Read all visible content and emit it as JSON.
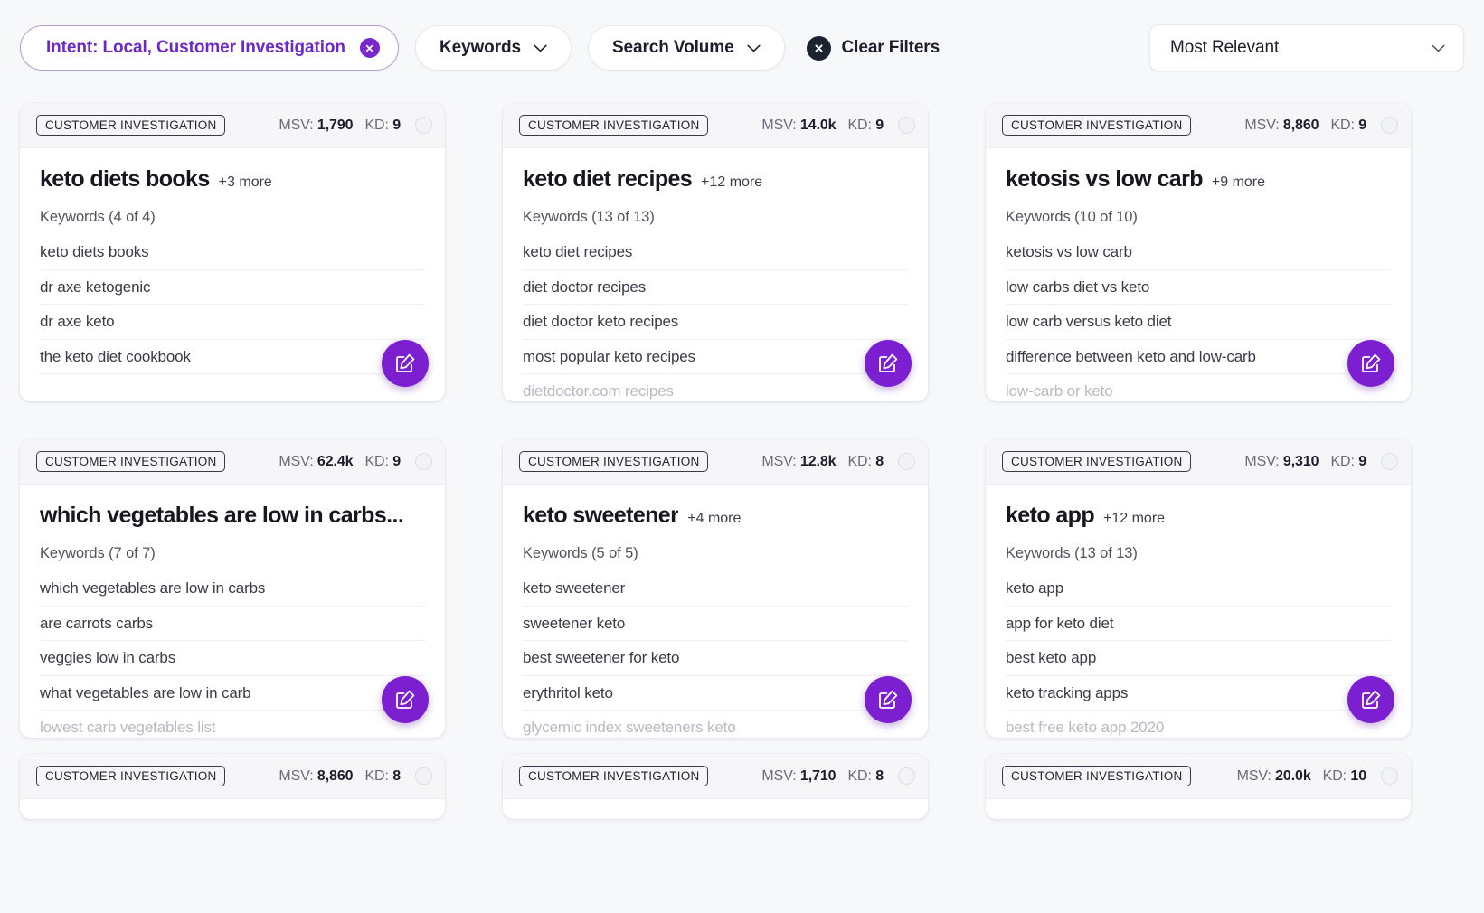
{
  "toolbar": {
    "intent_chip": {
      "label": "Intent: Local, Customer Investigation",
      "close_icon": "close-icon",
      "accent_color": "#7b27cf"
    },
    "keywords_filter": {
      "label": "Keywords",
      "icon": "chevron-down-icon"
    },
    "search_volume_filter": {
      "label": "Search Volume",
      "icon": "chevron-down-icon"
    },
    "clear_filters": {
      "label": "Clear Filters",
      "icon": "close-circle-icon"
    },
    "sort_select": {
      "value": "Most Relevant",
      "icon": "chevron-down-icon"
    }
  },
  "cards": [
    {
      "tag": "CUSTOMER INVESTIGATION",
      "msv_label": "MSV:",
      "msv_value": "1,790",
      "kd_label": "KD:",
      "kd_value": "9",
      "title": "keto diets books",
      "more": "+3 more",
      "keywords_count": "Keywords (4 of 4)",
      "keywords": [
        {
          "text": "keto diets books",
          "faded": false
        },
        {
          "text": "dr axe ketogenic",
          "faded": false
        },
        {
          "text": "dr axe keto",
          "faded": false
        },
        {
          "text": "the keto diet cookbook",
          "faded": false
        }
      ]
    },
    {
      "tag": "CUSTOMER INVESTIGATION",
      "msv_label": "MSV:",
      "msv_value": "14.0k",
      "kd_label": "KD:",
      "kd_value": "9",
      "title": "keto diet recipes",
      "more": "+12 more",
      "keywords_count": "Keywords (13 of 13)",
      "keywords": [
        {
          "text": "keto diet recipes",
          "faded": false
        },
        {
          "text": "diet doctor recipes",
          "faded": false
        },
        {
          "text": "diet doctor keto recipes",
          "faded": false
        },
        {
          "text": "most popular keto recipes",
          "faded": false
        },
        {
          "text": "dietdoctor.com recipes",
          "faded": true
        }
      ]
    },
    {
      "tag": "CUSTOMER INVESTIGATION",
      "msv_label": "MSV:",
      "msv_value": "8,860",
      "kd_label": "KD:",
      "kd_value": "9",
      "title": "ketosis vs low carb",
      "more": "+9 more",
      "keywords_count": "Keywords (10 of 10)",
      "keywords": [
        {
          "text": "ketosis vs low carb",
          "faded": false
        },
        {
          "text": "low carbs diet vs keto",
          "faded": false
        },
        {
          "text": "low carb versus keto diet",
          "faded": false
        },
        {
          "text": "difference between keto and low-carb",
          "faded": false
        },
        {
          "text": "low-carb or keto",
          "faded": true
        }
      ]
    },
    {
      "tag": "CUSTOMER INVESTIGATION",
      "msv_label": "MSV:",
      "msv_value": "62.4k",
      "kd_label": "KD:",
      "kd_value": "9",
      "title": "which vegetables are low in carbs...",
      "more": "",
      "keywords_count": "Keywords (7 of 7)",
      "keywords": [
        {
          "text": "which vegetables are low in carbs",
          "faded": false
        },
        {
          "text": "are carrots carbs",
          "faded": false
        },
        {
          "text": "veggies low in carbs",
          "faded": false
        },
        {
          "text": "what vegetables are low in carb",
          "faded": false
        },
        {
          "text": "lowest carb vegetables list",
          "faded": true
        }
      ]
    },
    {
      "tag": "CUSTOMER INVESTIGATION",
      "msv_label": "MSV:",
      "msv_value": "12.8k",
      "kd_label": "KD:",
      "kd_value": "8",
      "title": "keto sweetener",
      "more": "+4 more",
      "keywords_count": "Keywords (5 of 5)",
      "keywords": [
        {
          "text": "keto sweetener",
          "faded": false
        },
        {
          "text": "sweetener keto",
          "faded": false
        },
        {
          "text": "best sweetener for keto",
          "faded": false
        },
        {
          "text": "erythritol keto",
          "faded": false
        },
        {
          "text": "glycemic index sweeteners keto",
          "faded": true
        }
      ]
    },
    {
      "tag": "CUSTOMER INVESTIGATION",
      "msv_label": "MSV:",
      "msv_value": "9,310",
      "kd_label": "KD:",
      "kd_value": "9",
      "title": "keto app",
      "more": "+12 more",
      "keywords_count": "Keywords (13 of 13)",
      "keywords": [
        {
          "text": "keto app",
          "faded": false
        },
        {
          "text": "app for keto diet",
          "faded": false
        },
        {
          "text": "best keto app",
          "faded": false
        },
        {
          "text": "keto tracking apps",
          "faded": false
        },
        {
          "text": "best free keto app 2020",
          "faded": true
        }
      ]
    }
  ],
  "partial_cards": [
    {
      "tag": "CUSTOMER INVESTIGATION",
      "msv_label": "MSV:",
      "msv_value": "8,860",
      "kd_label": "KD:",
      "kd_value": "8"
    },
    {
      "tag": "CUSTOMER INVESTIGATION",
      "msv_label": "MSV:",
      "msv_value": "1,710",
      "kd_label": "KD:",
      "kd_value": "8"
    },
    {
      "tag": "CUSTOMER INVESTIGATION",
      "msv_label": "MSV:",
      "msv_value": "20.0k",
      "kd_label": "KD:",
      "kd_value": "10"
    }
  ]
}
